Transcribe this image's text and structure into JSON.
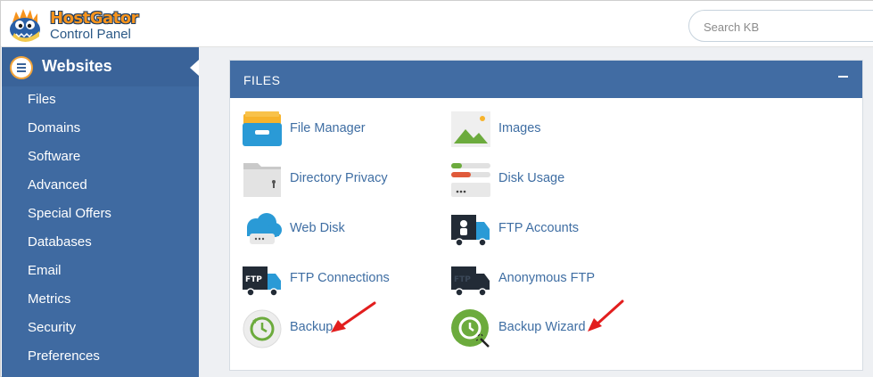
{
  "header": {
    "brand_name": "HostGator",
    "brand_subtitle": "Control Panel",
    "search_placeholder": "Search KB"
  },
  "sidebar": {
    "section_label": "Websites",
    "items": [
      {
        "label": "Files"
      },
      {
        "label": "Domains"
      },
      {
        "label": "Software"
      },
      {
        "label": "Advanced"
      },
      {
        "label": "Special Offers"
      },
      {
        "label": "Databases"
      },
      {
        "label": "Email"
      },
      {
        "label": "Metrics"
      },
      {
        "label": "Security"
      },
      {
        "label": "Preferences"
      }
    ]
  },
  "files_panel": {
    "title": "FILES",
    "items": [
      {
        "label": "File Manager",
        "icon": "file-manager-icon"
      },
      {
        "label": "Images",
        "icon": "images-icon"
      },
      {
        "label": "Directory Privacy",
        "icon": "directory-privacy-icon"
      },
      {
        "label": "Disk Usage",
        "icon": "disk-usage-icon"
      },
      {
        "label": "Web Disk",
        "icon": "web-disk-icon"
      },
      {
        "label": "FTP Accounts",
        "icon": "ftp-accounts-icon"
      },
      {
        "label": "FTP Connections",
        "icon": "ftp-connections-icon"
      },
      {
        "label": "Anonymous FTP",
        "icon": "anonymous-ftp-icon"
      },
      {
        "label": "Backup",
        "icon": "backup-icon"
      },
      {
        "label": "Backup Wizard",
        "icon": "backup-wizard-icon"
      }
    ]
  },
  "colors": {
    "sidebar_bg": "#3f6aa1",
    "panel_header_bg": "#416ca3",
    "link_text": "#3f6ea3",
    "arrow_red": "#e21e1e",
    "brand_orange": "#f7941d"
  }
}
